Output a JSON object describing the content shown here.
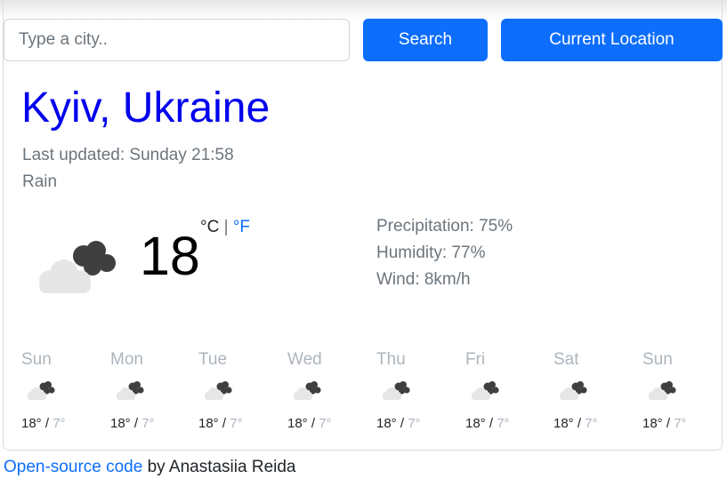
{
  "search": {
    "placeholder": "Type a city.."
  },
  "buttons": {
    "search_label": "Search",
    "location_label": "Current Location"
  },
  "current": {
    "city": "Kyiv, Ukraine",
    "last_updated": "Last updated: Sunday 21:58",
    "description": "Rain",
    "temperature": "18",
    "unit_c": "°C",
    "unit_sep": "|",
    "unit_f": "°F",
    "precipitation": "Precipitation: 75%",
    "humidity": "Humidity: 77%",
    "wind": "Wind: 8km/h",
    "icon": "rain-cloud-icon"
  },
  "forecast": [
    {
      "day": "Sun",
      "high": "18°",
      "low": "7°",
      "icon": "rain-cloud-icon"
    },
    {
      "day": "Mon",
      "high": "18°",
      "low": "7°",
      "icon": "rain-cloud-icon"
    },
    {
      "day": "Tue",
      "high": "18°",
      "low": "7°",
      "icon": "rain-cloud-icon"
    },
    {
      "day": "Wed",
      "high": "18°",
      "low": "7°",
      "icon": "rain-cloud-icon"
    },
    {
      "day": "Thu",
      "high": "18°",
      "low": "7°",
      "icon": "rain-cloud-icon"
    },
    {
      "day": "Fri",
      "high": "18°",
      "low": "7°",
      "icon": "rain-cloud-icon"
    },
    {
      "day": "Sat",
      "high": "18°",
      "low": "7°",
      "icon": "rain-cloud-icon"
    },
    {
      "day": "Sun",
      "high": "18°",
      "low": "7°",
      "icon": "rain-cloud-icon"
    }
  ],
  "footer": {
    "link_text": "Open-source code",
    "author_text": " by Anastasiia Reida"
  },
  "colors": {
    "primary": "#0d6efd",
    "city": "#0000ee",
    "muted": "#6c757d",
    "light_muted": "#adb5bd"
  }
}
